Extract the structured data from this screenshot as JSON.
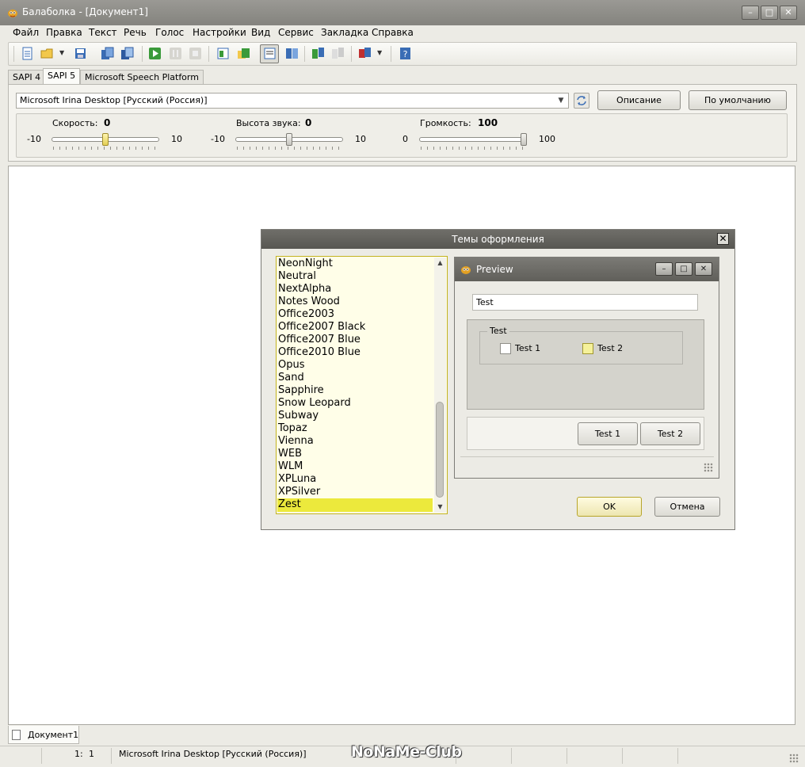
{
  "window": {
    "title": "Балаболка - [Документ1]",
    "minimize_label": "–",
    "maximize_label": "□",
    "close_label": "✕"
  },
  "menu": [
    "Файл",
    "Правка",
    "Текст",
    "Речь",
    "Голос",
    "Настройки",
    "Вид",
    "Сервис",
    "Закладка",
    "Справка"
  ],
  "toolbar_icons": [
    "new-document-icon",
    "open-folder-icon",
    "open-dropdown-icon",
    "save-icon",
    "read-clipboard-icon",
    "save-audio-icon",
    "play-icon",
    "pause-icon",
    "stop-icon",
    "speak-selection-icon",
    "speak-file-icon",
    "edit-mode-icon",
    "book-icon",
    "split-icon",
    "compare-icon",
    "voice-dropdown-icon",
    "help-icon"
  ],
  "engine_tabs": [
    "SAPI 4",
    "SAPI 5",
    "Microsoft Speech Platform"
  ],
  "voice": {
    "selected": "Microsoft Irina Desktop [Русский (Россия)]",
    "description_button": "Описание",
    "default_button": "По умолчанию"
  },
  "sliders": {
    "speed": {
      "label": "Скорость:",
      "value": "0",
      "min": "-10",
      "max": "10",
      "level": 0.5
    },
    "pitch": {
      "label": "Высота звука:",
      "value": "0",
      "min": "-10",
      "max": "10",
      "level": 0.5
    },
    "volume": {
      "label": "Громкость:",
      "value": "100",
      "min": "0",
      "max": "100",
      "level": 1.0
    }
  },
  "dialog": {
    "title": "Темы оформления",
    "themes": [
      "NeonNight",
      "Neutral",
      "NextAlpha",
      "Notes Wood",
      "Office2003",
      "Office2007 Black",
      "Office2007 Blue",
      "Office2010 Blue",
      "Opus",
      "Sand",
      "Sapphire",
      "Snow Leopard",
      "Subway",
      "Topaz",
      "Vienna",
      "WEB",
      "WLM",
      "XPLuna",
      "XPSilver",
      "Zest"
    ],
    "selected_theme": "Zest",
    "preview": {
      "title": "Preview",
      "input_value": "Test",
      "group_label": "Test",
      "checkbox1": "Test 1",
      "checkbox2": "Test 2",
      "button1": "Test 1",
      "button2": "Test 2"
    },
    "ok": "OK",
    "cancel": "Отмена"
  },
  "document_tab": "Документ1",
  "status": {
    "line": "1:",
    "col": "1",
    "voice": "Microsoft Irina Desktop [Русский (Россия)]",
    "watermark": "NoNaMe-Club"
  },
  "colors": {
    "accent_yellow": "#ece93c",
    "titlebar": "#8a8984",
    "list_bg": "#fffee8"
  }
}
